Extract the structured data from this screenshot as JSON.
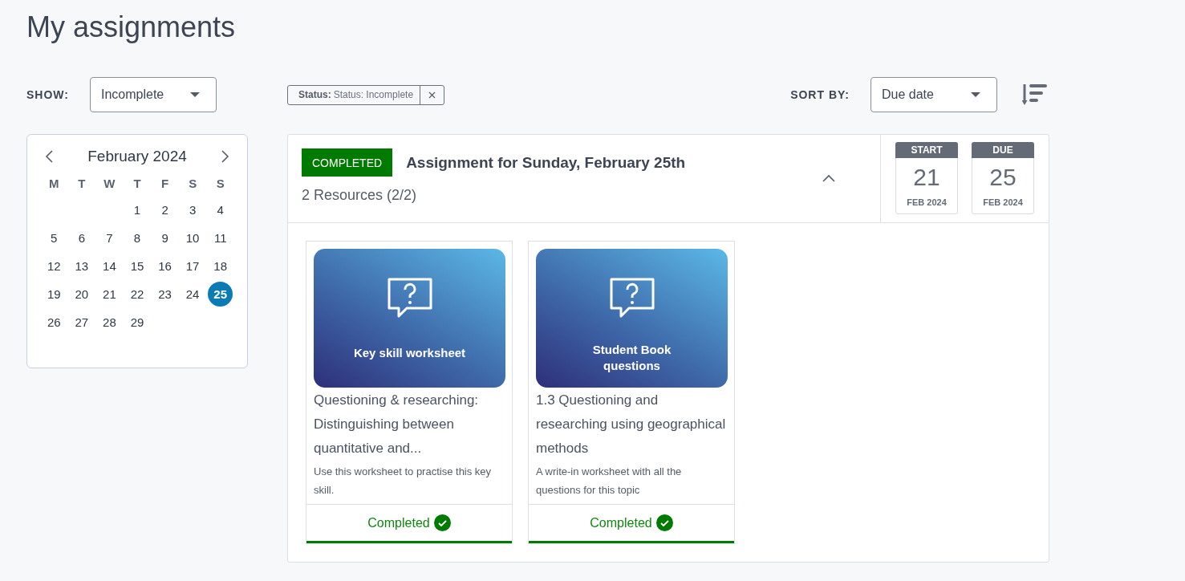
{
  "page_title": "My assignments",
  "show_filter": {
    "label": "SHOW:",
    "value": "Incomplete"
  },
  "active_filters": [
    {
      "key": "Status:",
      "value": "Status: Incomplete"
    }
  ],
  "sort": {
    "label": "SORT BY:",
    "value": "Due date"
  },
  "calendar": {
    "month": "February 2024",
    "weekdays": [
      "M",
      "T",
      "W",
      "T",
      "F",
      "S",
      "S"
    ],
    "weeks": [
      [
        {
          "day": "1",
          "selected": false
        },
        {
          "day": "2",
          "selected": false
        },
        {
          "day": "3",
          "selected": false
        },
        {
          "day": "4",
          "selected": false
        }
      ],
      [
        {
          "day": "5",
          "selected": false
        },
        {
          "day": "6",
          "selected": false
        },
        {
          "day": "7",
          "selected": false
        },
        {
          "day": "8",
          "selected": false
        },
        {
          "day": "9",
          "selected": false
        },
        {
          "day": "10",
          "selected": false
        },
        {
          "day": "11",
          "selected": false
        }
      ],
      [
        {
          "day": "12",
          "selected": false
        },
        {
          "day": "13",
          "selected": false
        },
        {
          "day": "14",
          "selected": false
        },
        {
          "day": "15",
          "selected": false
        },
        {
          "day": "16",
          "selected": false
        },
        {
          "day": "17",
          "selected": false
        },
        {
          "day": "18",
          "selected": false
        }
      ],
      [
        {
          "day": "19",
          "selected": false
        },
        {
          "day": "20",
          "selected": false
        },
        {
          "day": "21",
          "selected": false
        },
        {
          "day": "22",
          "selected": false
        },
        {
          "day": "23",
          "selected": false
        },
        {
          "day": "24",
          "selected": false
        },
        {
          "day": "25",
          "selected": true
        }
      ],
      [
        {
          "day": "26",
          "selected": false
        },
        {
          "day": "27",
          "selected": false
        },
        {
          "day": "28",
          "selected": false
        },
        {
          "day": "29",
          "selected": false
        }
      ]
    ]
  },
  "assignment": {
    "status": "COMPLETED",
    "title": "Assignment for Sunday, February 25th",
    "resources_count": "2 Resources (2/2)",
    "expanded": true,
    "dates": [
      {
        "label": "START",
        "day": "21",
        "month": "FEB 2024"
      },
      {
        "label": "DUE",
        "day": "25",
        "month": "FEB 2024"
      }
    ],
    "resources": [
      {
        "tile_title": "Key skill worksheet",
        "title": "Questioning & researching: Distinguishing between quantitative and...",
        "description": "Use this worksheet to practise this key skill.",
        "status": "Completed",
        "completed": true
      },
      {
        "tile_title": "Student Book questions",
        "title": "1.3 Questioning and researching using geographical methods",
        "description": "A write-in worksheet with all the questions for this topic",
        "status": "Completed",
        "completed": true
      }
    ]
  }
}
